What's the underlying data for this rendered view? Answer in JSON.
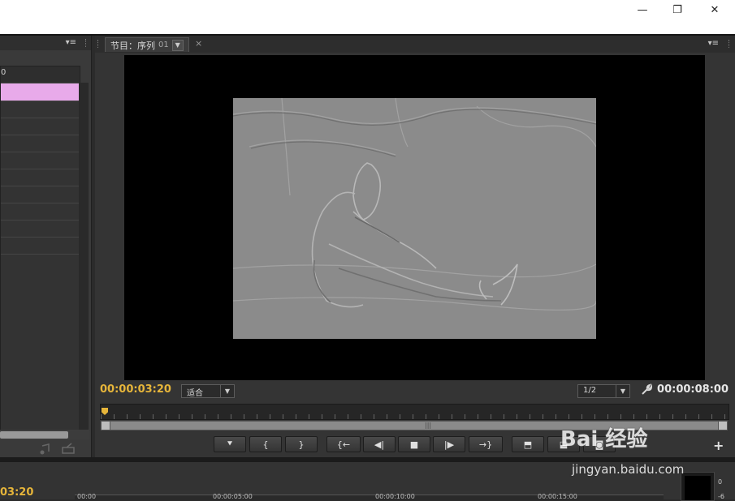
{
  "window": {
    "minimize_glyph": "—",
    "restore_glyph": "❐",
    "close_glyph": "✕"
  },
  "left_panel": {
    "ruler_label": "0",
    "menu_glyph": "▾≡"
  },
  "monitor": {
    "tab_title": "节目：序列",
    "tab_sequence": "01",
    "tab_dropdown_glyph": "▼",
    "tab_close_glyph": "×",
    "menu_glyph": "▾≡",
    "current_timecode": "00:00:03:20",
    "duration_timecode": "00:00:08:00",
    "fit_value": "适合",
    "resolution_value": "1/2",
    "select_arrow": "▼",
    "zoom_grip": "|||",
    "add_glyph": "+",
    "transport": [
      {
        "name": "add-marker-button",
        "glyph": "⯆"
      },
      {
        "name": "mark-in-button",
        "glyph": "{"
      },
      {
        "name": "mark-out-button",
        "glyph": "}"
      },
      {
        "name": "go-to-in-button",
        "glyph": "{←"
      },
      {
        "name": "step-back-button",
        "glyph": "◀|"
      },
      {
        "name": "stop-button",
        "glyph": "■"
      },
      {
        "name": "step-forward-button",
        "glyph": "|▶"
      },
      {
        "name": "go-to-out-button",
        "glyph": "→}"
      },
      {
        "name": "lift-button",
        "glyph": "⬒"
      },
      {
        "name": "extract-button",
        "glyph": "⬓"
      },
      {
        "name": "export-frame-button",
        "glyph": "◙"
      }
    ],
    "wrench_glyph": "🔧"
  },
  "bottom": {
    "timecode": "03:20",
    "ruler_labels": [
      "00:00",
      "00:00:05:00",
      "00:00:10:00",
      "00:00:15:00"
    ],
    "meter_labels": [
      "0",
      "-6"
    ]
  },
  "watermark": {
    "logo": "Bai 经验",
    "url": "jingyan.baidu.com"
  },
  "colors": {
    "accent_timecode": "#e6b53a",
    "selection": "#e8aaea",
    "background": "#343434"
  }
}
